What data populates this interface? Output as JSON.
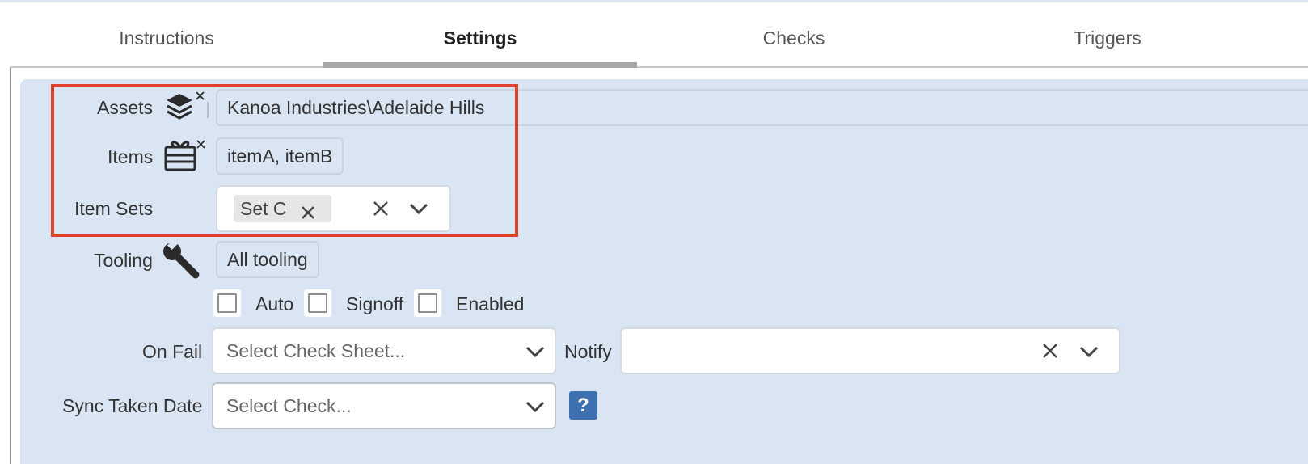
{
  "tabs": [
    {
      "label": "Instructions",
      "active": false
    },
    {
      "label": "Settings",
      "active": true
    },
    {
      "label": "Checks",
      "active": false
    },
    {
      "label": "Triggers",
      "active": false
    }
  ],
  "form": {
    "assets": {
      "label": "Assets",
      "icon": "layers-icon",
      "value": "Kanoa Industries\\Adelaide Hills"
    },
    "items": {
      "label": "Items",
      "icon": "gift-icon",
      "value": "itemA, itemB"
    },
    "item_sets": {
      "label": "Item Sets",
      "chips": [
        "Set C"
      ]
    },
    "tooling": {
      "label": "Tooling",
      "icon": "wrench-icon",
      "value": "All tooling"
    },
    "checkboxes": [
      {
        "label": "Auto",
        "checked": false
      },
      {
        "label": "Signoff",
        "checked": false
      },
      {
        "label": "Enabled",
        "checked": false
      }
    ],
    "on_fail": {
      "label": "On Fail",
      "placeholder": "Select Check Sheet..."
    },
    "notify": {
      "label": "Notify",
      "value": ""
    },
    "sync_taken_date": {
      "label": "Sync Taken Date",
      "placeholder": "Select Check..."
    },
    "help_glyph": "?"
  },
  "colors": {
    "panel_bg": "#dae5f3",
    "highlight": "#e03f2a",
    "help_button": "#3e6fae",
    "active_tab_underline": "#a9a9a9"
  }
}
